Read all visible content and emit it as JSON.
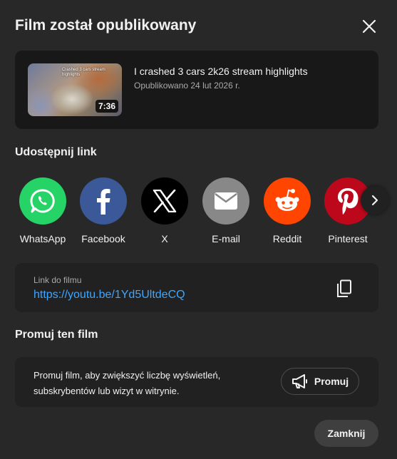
{
  "dialog": {
    "title": "Film został opublikowany"
  },
  "video": {
    "thumbnail_caption": "Crashed 3 cars stream highlights",
    "duration": "7:36",
    "title": "I crashed 3 cars 2k26 stream highlights",
    "meta": "Opublikowano 24 lut 2026 r."
  },
  "share": {
    "heading": "Udostępnij link",
    "items": [
      {
        "label": "WhatsApp",
        "icon": "whatsapp-icon",
        "color": "#25d366"
      },
      {
        "label": "Facebook",
        "icon": "facebook-icon",
        "color": "#3b5998"
      },
      {
        "label": "X",
        "icon": "x-icon",
        "color": "#000000"
      },
      {
        "label": "E-mail",
        "icon": "email-icon",
        "color": "#888888"
      },
      {
        "label": "Reddit",
        "icon": "reddit-icon",
        "color": "#ff4500"
      },
      {
        "label": "Pinterest",
        "icon": "pinterest-icon",
        "color": "#bd081c"
      }
    ]
  },
  "link": {
    "label": "Link do filmu",
    "url": "https://youtu.be/1Yd5UltdeCQ"
  },
  "promote": {
    "heading": "Promuj ten film",
    "text": "Promuj film, aby zwiększyć liczbę wyświetleń, subskrybentów lub wizyt w witrynie.",
    "button_label": "Promuj"
  },
  "footer": {
    "close_label": "Zamknij"
  },
  "colors": {
    "background": "#282828",
    "card": "#181818",
    "link": "#3ea6ff"
  }
}
